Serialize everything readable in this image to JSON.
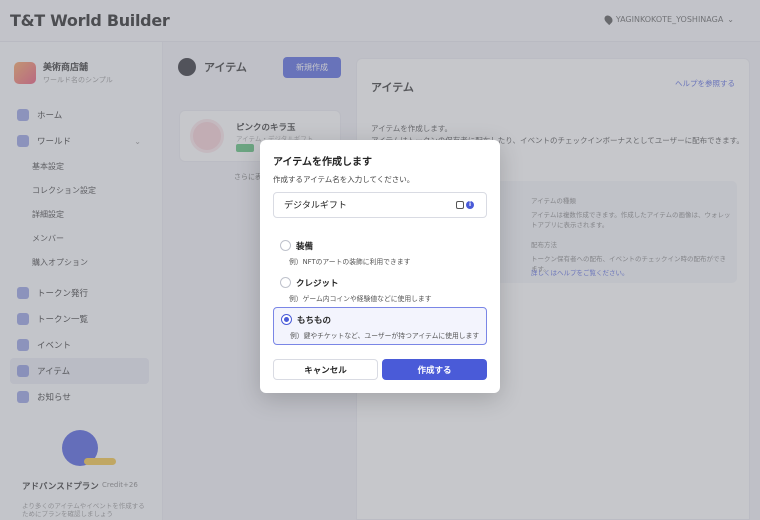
{
  "app": {
    "logo": "T&T World Builder",
    "account": "YAGINKOKOTE_YOSHINAGA"
  },
  "sidebar": {
    "org_name": "美術商店舗",
    "org_sub": "ワールド名のシンプル",
    "items": [
      {
        "label": "ホーム"
      },
      {
        "label": "ワールド"
      },
      {
        "label": "基本設定"
      },
      {
        "label": "コレクション設定"
      },
      {
        "label": "詳細設定"
      },
      {
        "label": "メンバー"
      },
      {
        "label": "購入オプション"
      },
      {
        "label": "トークン発行"
      },
      {
        "label": "トークン一覧"
      },
      {
        "label": "イベント"
      },
      {
        "label": "アイテム"
      },
      {
        "label": "お知らせ"
      }
    ],
    "promo_title": "アドバンスドプラン",
    "promo_tag": "Credit+26",
    "promo_desc": "より多くのアイテムやイベントを作成するためにプランを確認しましょう"
  },
  "main": {
    "page_title": "アイテム",
    "new_button": "新規作成",
    "item_card": {
      "name": "ピンクのキラ玉",
      "meta": "アイテム・デジタルギフト"
    },
    "more_link": "さらに表示",
    "panel_title": "アイテム",
    "help_link": "ヘルプを参照する",
    "intro": "アイテムを作成します。\nアイテムはトークンの保有者に配布したり、イベントのチェックインボーナスとしてユーザーに配布できます。",
    "box_lines": [
      "アイテムの種類",
      "アイテムは複数作成できます。作成したアイテムの画像は、ウォレットアプリに表示されます。",
      "配布方法",
      "トークン保有者への配布、イベントのチェックイン時の配布ができます。",
      "詳しくはヘルプをご覧ください。"
    ]
  },
  "modal": {
    "title": "アイテムを作成します",
    "description": "作成するアイテム名を入力してください。",
    "input_value": "デジタルギフト",
    "options": [
      {
        "label": "装備",
        "desc": "例）NFTのアートの装飾に利用できます",
        "selected": false
      },
      {
        "label": "クレジット",
        "desc": "例）ゲーム内コインや経験値などに使用します",
        "selected": false
      },
      {
        "label": "もちもの",
        "desc": "例）鍵やチケットなど、ユーザーが持つアイテムに使用します",
        "selected": true
      }
    ],
    "cancel_label": "キャンセル",
    "create_label": "作成する"
  }
}
